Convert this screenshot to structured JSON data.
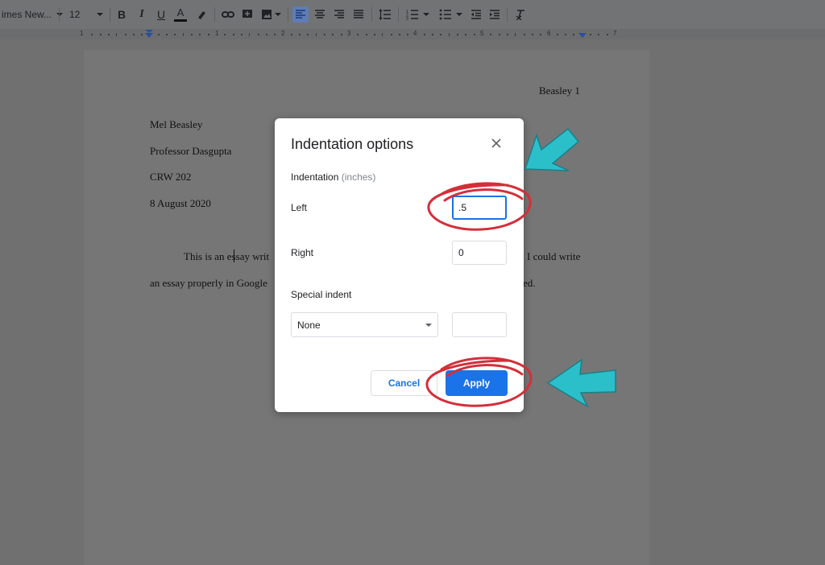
{
  "toolbar": {
    "font_name": "imes New...",
    "font_size": "12",
    "icons": [
      "bold-icon",
      "italic-icon",
      "underline-icon",
      "text-color-icon",
      "highlight-icon",
      "link-icon",
      "add-comment-icon",
      "insert-image-icon",
      "align-left-icon",
      "align-center-icon",
      "align-right-icon",
      "justify-icon",
      "line-spacing-icon",
      "numbered-list-icon",
      "bulleted-list-icon",
      "decrease-indent-icon",
      "increase-indent-icon",
      "clear-formatting-icon"
    ],
    "active_icon": "align-left-icon"
  },
  "ruler": {
    "numbers": [
      "1",
      "1",
      "2",
      "3",
      "4",
      "5",
      "6",
      "7"
    ]
  },
  "document": {
    "header": "Beasley 1",
    "lines": [
      "Mel Beasley",
      "Professor Dasgupta",
      "CRW 202",
      "8 August 2020"
    ],
    "body_line1_left": "This is an essay writ",
    "body_line1_right": "I could write",
    "body_line2_left": "an essay properly in Google",
    "body_line2_right": "ed."
  },
  "dialog": {
    "title": "Indentation options",
    "section_label": "Indentation",
    "section_hint": "(inches)",
    "left_label": "Left",
    "left_value": ".5",
    "right_label": "Right",
    "right_value": "0",
    "special_label": "Special indent",
    "special_selected": "None",
    "special_value": "",
    "cancel_label": "Cancel",
    "apply_label": "Apply"
  },
  "colors": {
    "accent": "#1a73e8",
    "annotation_circle": "#d32f3a",
    "annotation_arrow": "#2bbfca"
  }
}
